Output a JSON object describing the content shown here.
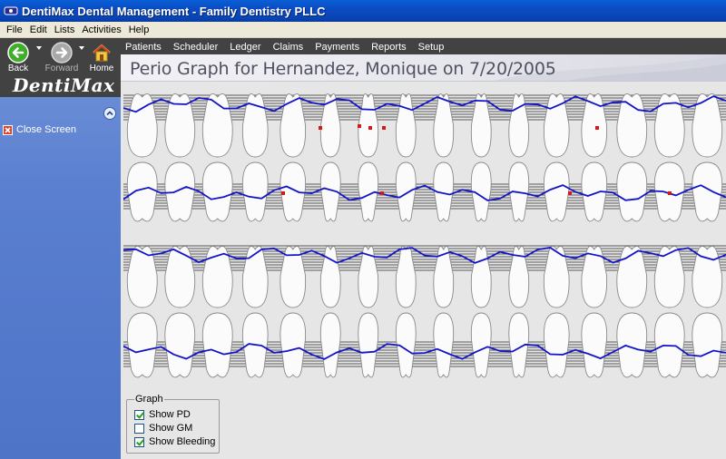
{
  "window": {
    "title": "DentiMax Dental Management - Family Dentistry PLLC"
  },
  "menu": [
    "File",
    "Edit",
    "Lists",
    "Activities",
    "Help"
  ],
  "toolbar": {
    "back": "Back",
    "forward": "Forward",
    "home": "Home"
  },
  "nav": [
    "Patients",
    "Scheduler",
    "Ledger",
    "Claims",
    "Payments",
    "Reports",
    "Setup"
  ],
  "sidebar": {
    "logo": "DentiMax",
    "close_screen": "Close Screen"
  },
  "page": {
    "title": "Perio Graph for Hernandez, Monique on 7/20/2005"
  },
  "graph": {
    "legend": "Graph",
    "options": [
      {
        "label": "Show PD",
        "checked": true
      },
      {
        "label": "Show GM",
        "checked": false
      },
      {
        "label": "Show Bleeding",
        "checked": true
      }
    ]
  },
  "colors": {
    "line": "#1414c8",
    "bleed": "#d81818",
    "sidebar": "#5a7fd0",
    "toolbar": "#424242"
  },
  "icons": {
    "back": "back-arrow-icon",
    "forward": "forward-arrow-icon",
    "home": "home-icon",
    "close": "close-screen-icon",
    "collapse": "collapse-up-icon"
  }
}
